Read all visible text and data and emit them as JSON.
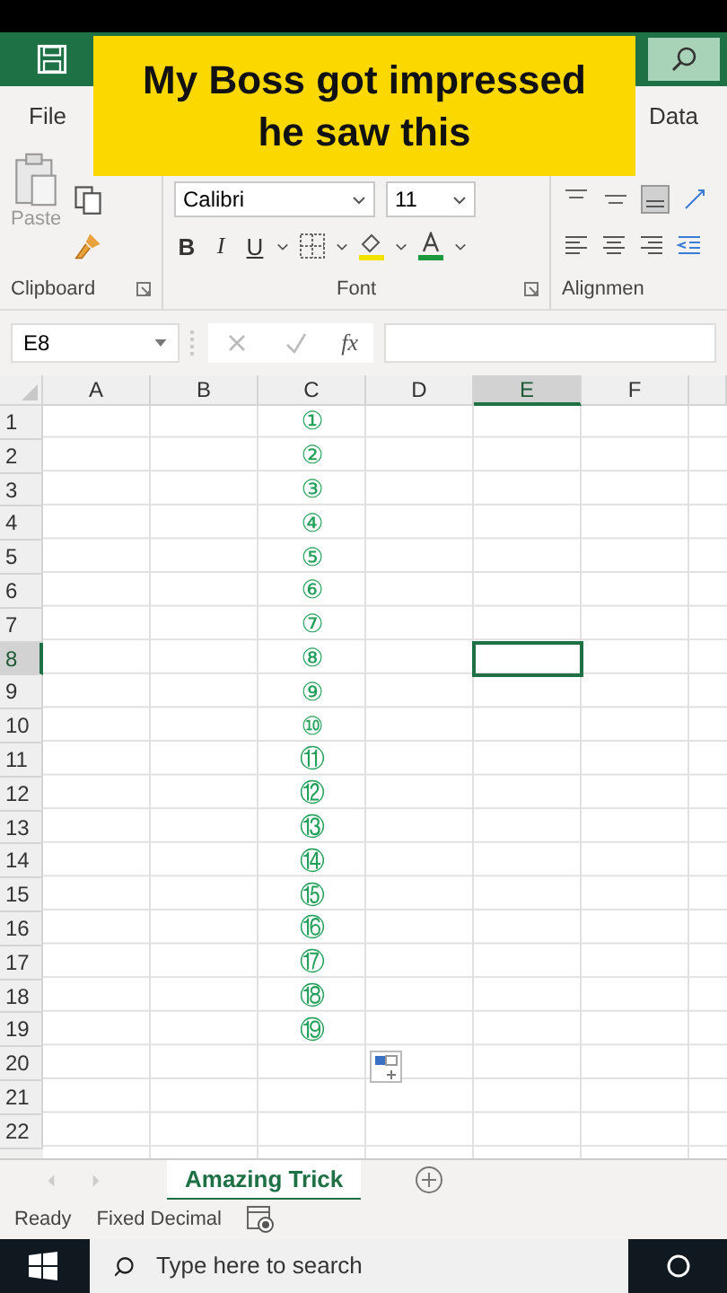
{
  "caption": [
    "My Boss got impressed",
    "he saw this"
  ],
  "ribbon_tabs": [
    {
      "label": "File",
      "selected": false
    },
    {
      "label": "Data",
      "selected": false
    }
  ],
  "ribbon": {
    "paste_label": "Paste",
    "font_name": "Calibri",
    "font_size": "11",
    "bold": "B",
    "italic": "I",
    "underline": "U",
    "groups": [
      "Clipboard",
      "Font",
      "Alignmen"
    ]
  },
  "formula_bar": {
    "name_box": "E8",
    "function_label": "fx"
  },
  "columns": [
    {
      "label": "A",
      "selected": false
    },
    {
      "label": "B",
      "selected": false
    },
    {
      "label": "C",
      "selected": false
    },
    {
      "label": "D",
      "selected": false
    },
    {
      "label": "E",
      "selected": true
    },
    {
      "label": "F",
      "selected": false
    }
  ],
  "rows": [
    {
      "label": "1",
      "selected": false,
      "c": "①"
    },
    {
      "label": "2",
      "selected": false,
      "c": "②"
    },
    {
      "label": "3",
      "selected": false,
      "c": "③"
    },
    {
      "label": "4",
      "selected": false,
      "c": "④"
    },
    {
      "label": "5",
      "selected": false,
      "c": "⑤"
    },
    {
      "label": "6",
      "selected": false,
      "c": "⑥"
    },
    {
      "label": "7",
      "selected": false,
      "c": "⑦"
    },
    {
      "label": "8",
      "selected": true,
      "c": "⑧"
    },
    {
      "label": "9",
      "selected": false,
      "c": "⑨"
    },
    {
      "label": "10",
      "selected": false,
      "c": "⑩"
    },
    {
      "label": "11",
      "selected": false,
      "c": "⑪"
    },
    {
      "label": "12",
      "selected": false,
      "c": "⑫"
    },
    {
      "label": "13",
      "selected": false,
      "c": "⑬"
    },
    {
      "label": "14",
      "selected": false,
      "c": "⑭"
    },
    {
      "label": "15",
      "selected": false,
      "c": "⑮"
    },
    {
      "label": "16",
      "selected": false,
      "c": "⑯"
    },
    {
      "label": "17",
      "selected": false,
      "c": "⑰"
    },
    {
      "label": "18",
      "selected": false,
      "c": "⑱"
    },
    {
      "label": "19",
      "selected": false,
      "c": "⑲"
    },
    {
      "label": "20",
      "selected": false
    },
    {
      "label": "21",
      "selected": false
    },
    {
      "label": "22",
      "selected": false
    }
  ],
  "sheet_tabs": [
    {
      "label": "Amazing Trick",
      "selected": true
    }
  ],
  "status_bar": {
    "items": [
      "Ready",
      "Fixed Decimal"
    ]
  },
  "taskbar": {
    "search_placeholder": "Type here to search"
  }
}
